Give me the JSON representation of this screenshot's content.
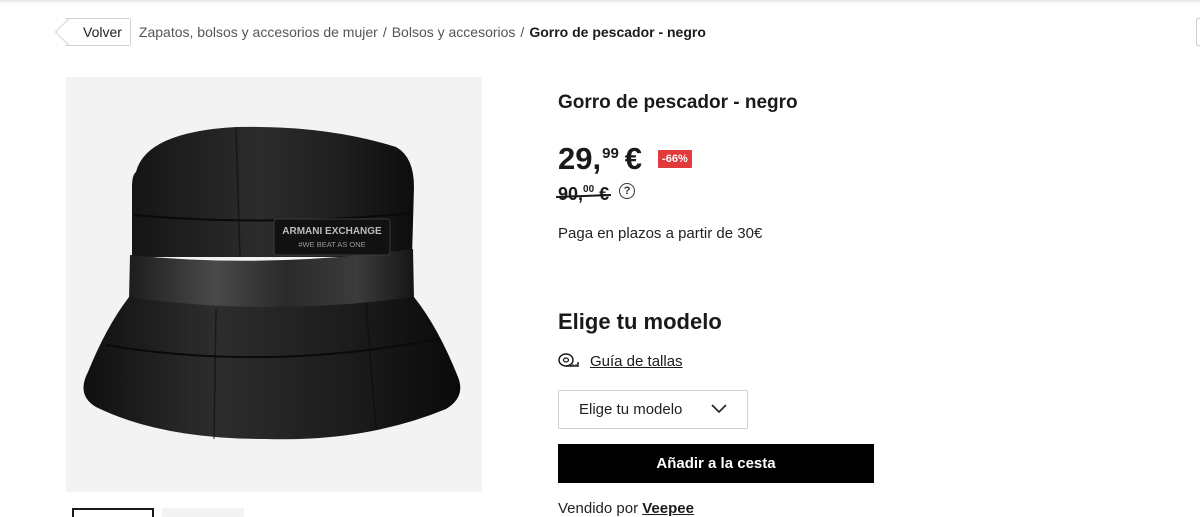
{
  "breadcrumb": {
    "back_label": "Volver",
    "items": [
      "Zapatos, bolsos y accesorios de mujer",
      "Bolsos y accesorios"
    ],
    "separator": "/",
    "current": "Gorro de pescador - negro"
  },
  "product": {
    "image_alt": "Gorro de pescador negro",
    "brand_label_line1": "ARMANI EXCHANGE",
    "brand_label_line2": "#WE BEAT AS ONE",
    "title": "Gorro de pescador - negro",
    "price": {
      "integer": "29,",
      "decimals": "99",
      "currency": "€"
    },
    "discount": "-66%",
    "old_price": {
      "integer": "90,",
      "decimals": "00",
      "currency": "€"
    },
    "info_icon": "question-circle-icon",
    "installments": "Paga en plazos a partir de 30€",
    "choose_heading": "Elige tu modelo",
    "size_guide_label": "Guía de tallas",
    "size_guide_icon": "measuring-tape-icon",
    "select_placeholder": "Elige tu modelo",
    "add_to_cart": "Añadir a la cesta",
    "sold_by_prefix": "Vendido por",
    "seller": "Veepee"
  },
  "colors": {
    "discount_badge": "#e03a3a",
    "button_bg": "#000000",
    "image_bg": "#f3f3f3"
  }
}
